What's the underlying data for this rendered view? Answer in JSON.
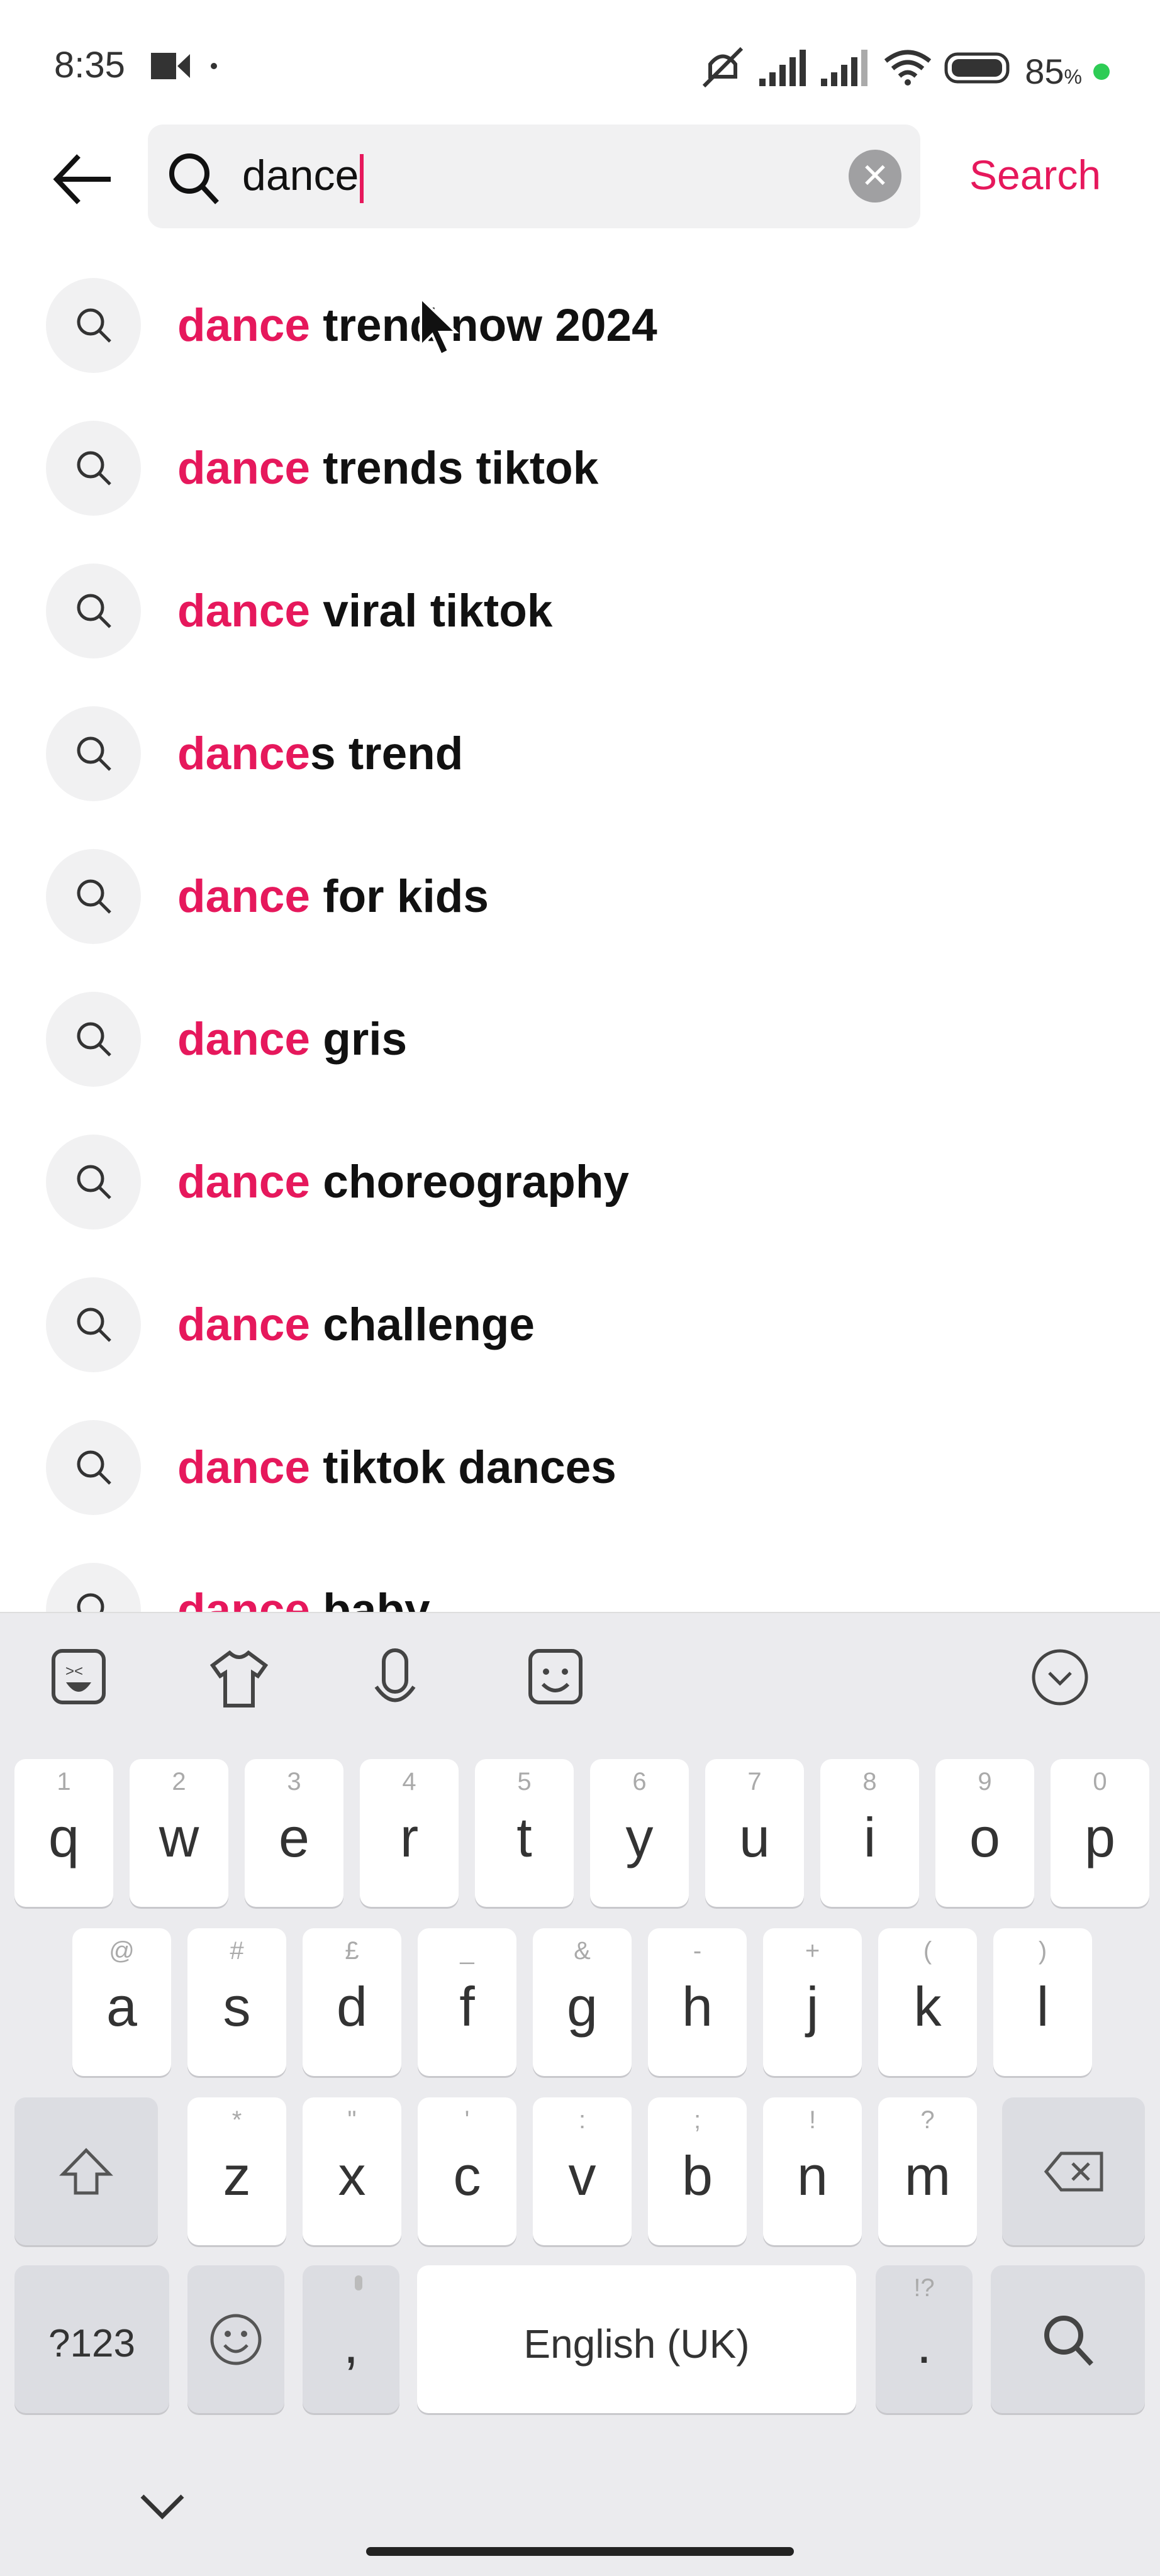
{
  "status": {
    "time": "8:35",
    "battery": "85",
    "battery_unit": "%",
    "battery_dot_color": "#2ecc55"
  },
  "search": {
    "query": "dance",
    "button": "Search",
    "accent": "#e6185c"
  },
  "suggestions": [
    {
      "hl": "dance",
      "rest": " trend now 2024"
    },
    {
      "hl": "dance",
      "rest": " trends tiktok"
    },
    {
      "hl": "dance",
      "rest": " viral tiktok"
    },
    {
      "hl": "dance",
      "rest": "s trend"
    },
    {
      "hl": "dance",
      "rest": " for kids"
    },
    {
      "hl": "dance",
      "rest": " gris"
    },
    {
      "hl": "dance",
      "rest": " choreography"
    },
    {
      "hl": "dance",
      "rest": " challenge"
    },
    {
      "hl": "dance",
      "rest": " tiktok dances"
    },
    {
      "hl": "dance",
      "rest": " baby"
    }
  ],
  "keyboard": {
    "row1": [
      [
        "q",
        "1"
      ],
      [
        "w",
        "2"
      ],
      [
        "e",
        "3"
      ],
      [
        "r",
        "4"
      ],
      [
        "t",
        "5"
      ],
      [
        "y",
        "6"
      ],
      [
        "u",
        "7"
      ],
      [
        "i",
        "8"
      ],
      [
        "o",
        "9"
      ],
      [
        "p",
        "0"
      ]
    ],
    "row2": [
      [
        "a",
        "@"
      ],
      [
        "s",
        "#"
      ],
      [
        "d",
        "£"
      ],
      [
        "f",
        "_"
      ],
      [
        "g",
        "&"
      ],
      [
        "h",
        "-"
      ],
      [
        "j",
        "+"
      ],
      [
        "k",
        "("
      ],
      [
        "l",
        ")"
      ]
    ],
    "row3": [
      [
        "z",
        "*"
      ],
      [
        "x",
        "\""
      ],
      [
        "c",
        "'"
      ],
      [
        "v",
        ":"
      ],
      [
        "b",
        ";"
      ],
      [
        "n",
        "!"
      ],
      [
        "m",
        "?"
      ]
    ],
    "symbols": "?123",
    "comma": ",",
    "space": "English (UK)",
    "period": ".",
    "period_sub": "!?"
  }
}
